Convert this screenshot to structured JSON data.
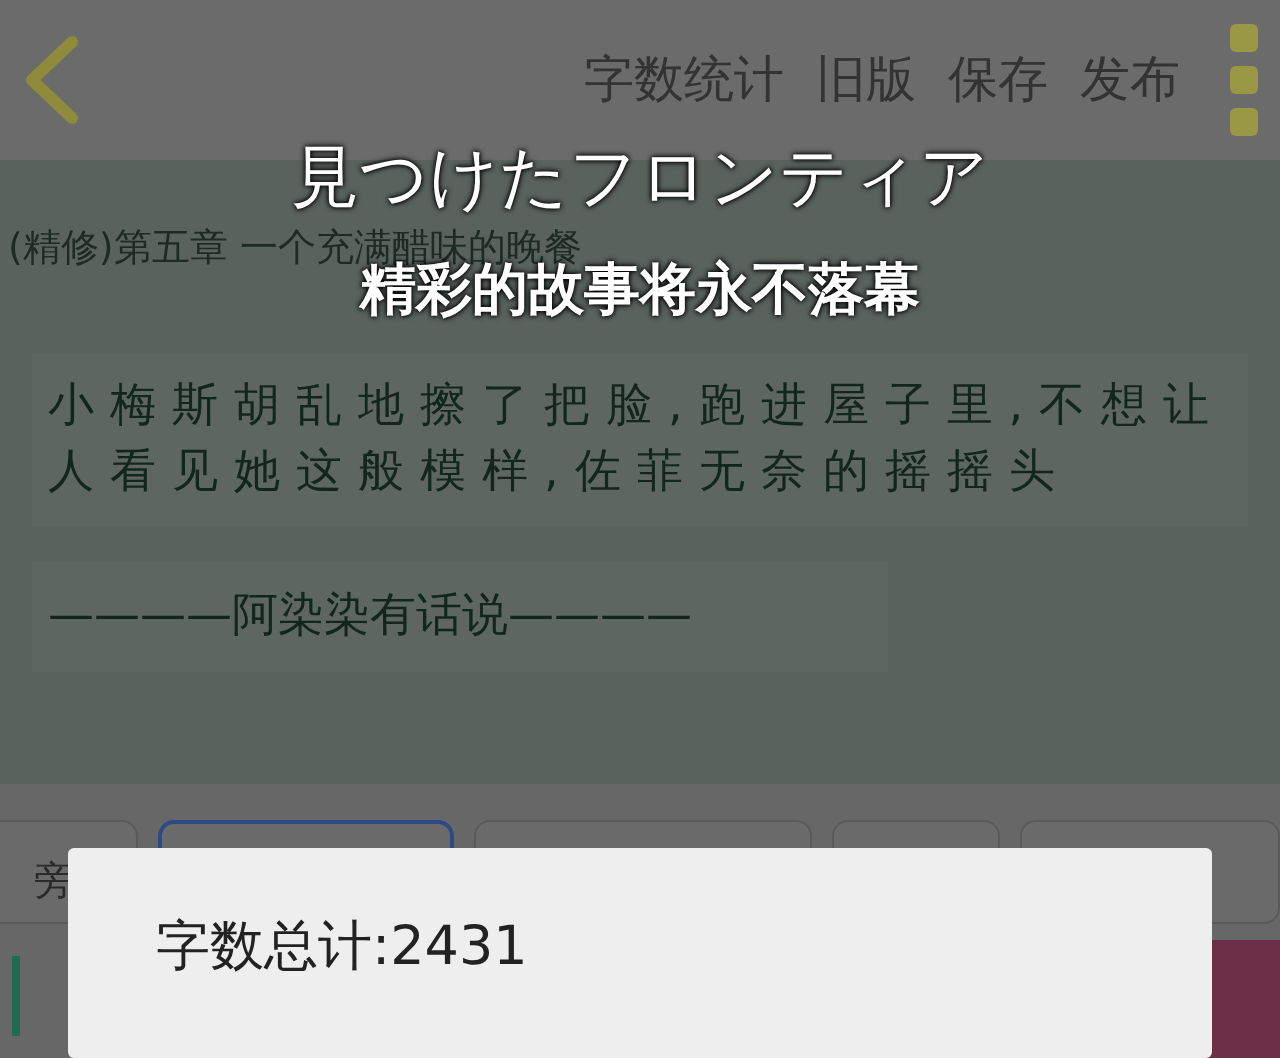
{
  "top_bar": {
    "actions": [
      "字数统计",
      "旧版",
      "保存",
      "发布"
    ]
  },
  "chapter_title": "(精修)第五章 一个充满醋味的晚餐",
  "paragraph": "小梅斯胡乱地擦了把脸,跑进屋子里,不想让人看见她这般模样,佐菲无奈的摇摇头",
  "author_note": "————阿染染有话说————",
  "toolbar_chips": [
    {
      "label": "旁",
      "selected": false
    },
    {
      "selected": true
    },
    {
      "selected": false
    },
    {
      "selected": false
    },
    {
      "selected": false
    }
  ],
  "overlay_captions": [
    "見つけたフロンティア",
    "精彩的故事将永不落幕"
  ],
  "dialog": {
    "text": "字数总计:2431"
  }
}
